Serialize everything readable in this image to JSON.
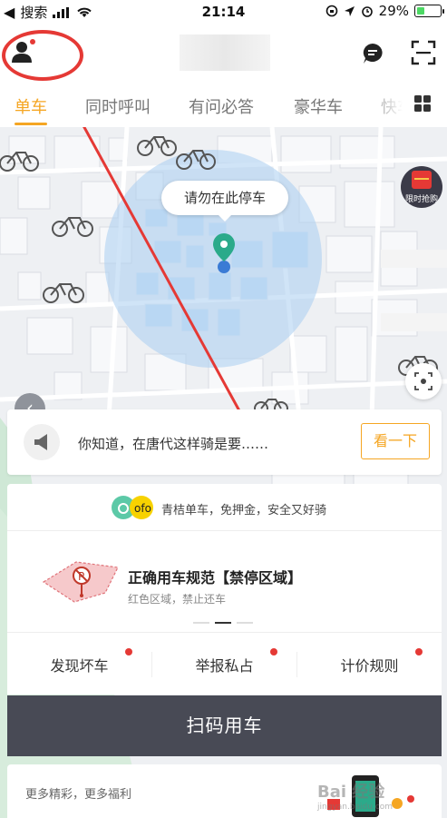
{
  "status_bar": {
    "back_app": "搜索",
    "time": "21:14",
    "battery": "29%"
  },
  "tabs": [
    {
      "label": "单车",
      "active": true
    },
    {
      "label": "同时呼叫",
      "active": false
    },
    {
      "label": "有问必答",
      "active": false
    },
    {
      "label": "豪华车",
      "active": false
    },
    {
      "label": "快车",
      "active": false
    }
  ],
  "map": {
    "tooltip": "请勿在此停车",
    "promo_label": "限时抢购",
    "colors": {
      "zone": "#a9cdf0",
      "pin": "#2baa8a",
      "annotation": "#e53935"
    }
  },
  "notice": {
    "text": "你知道，在唐代这样骑是要……",
    "button": "看一下"
  },
  "brand": {
    "logo_text": "ofo",
    "text": "青桔单车，免押金，安全又好骑"
  },
  "rule": {
    "title": "正确用车规范【禁停区域】",
    "subtitle": "红色区域，禁止还车"
  },
  "actions": [
    {
      "label": "发现坏车"
    },
    {
      "label": "举报私占"
    },
    {
      "label": "计价规则"
    }
  ],
  "main_button": "扫码用车",
  "bottom": {
    "text": "更多精彩，更多福利"
  },
  "watermark": {
    "main": "Bai 经验",
    "sub": "jingyan.baidu.com"
  },
  "icons": [
    "avatar-icon",
    "message-icon",
    "scan-icon",
    "grid-icon",
    "gift-icon",
    "locate-icon",
    "megaphone-icon",
    "bike-icon",
    "map-pin-icon",
    "chevron-left-icon"
  ],
  "accent": "#f5a623"
}
